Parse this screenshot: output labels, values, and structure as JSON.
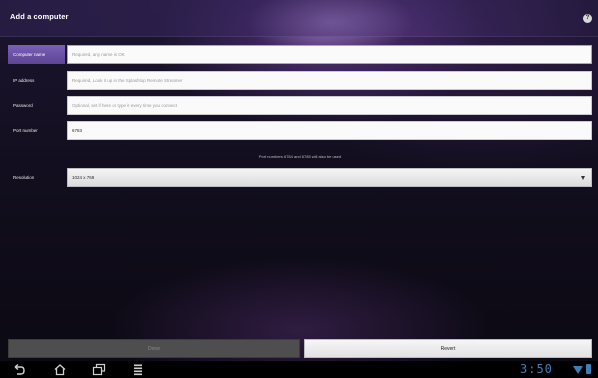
{
  "header": {
    "title": "Add a computer",
    "help_icon": "question-circle-icon",
    "help_glyph": "?"
  },
  "form": {
    "computer_name": {
      "label": "Computer name",
      "placeholder": "Required, any name is OK"
    },
    "ip_address": {
      "label": "IP address",
      "placeholder": "Required, Look it up in the Splashtop Remote Streamer"
    },
    "password": {
      "label": "Password",
      "placeholder": "Optional, set if here or type it every time you connect"
    },
    "port_number": {
      "label": "Port number",
      "value": "6783"
    },
    "hint": "Port numbers 6784 and 6785 will also be used",
    "resolution": {
      "label": "Resolution",
      "value": "1024 x 768"
    }
  },
  "buttons": {
    "done": "Done",
    "revert": "Revert"
  },
  "navbar": {
    "back_icon": "back-arrow-icon",
    "home_icon": "home-icon",
    "recent_icon": "recent-apps-icon",
    "menu_icon": "menu-icon",
    "clock": "3:50"
  },
  "colors": {
    "accent": "#6f55ac",
    "focus_border": "#f0a020",
    "clock": "#3f7fb8"
  }
}
